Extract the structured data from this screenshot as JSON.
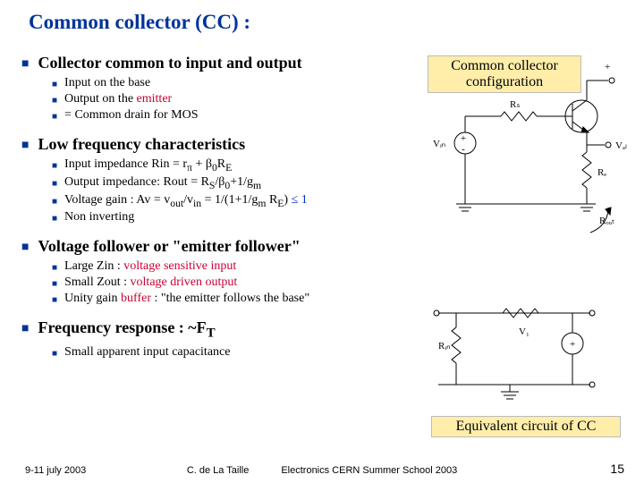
{
  "title": "Common collector (CC)  :",
  "bullets": [
    {
      "level": 1,
      "t": "Collector common to input and output"
    },
    {
      "level": 2,
      "t": "Input on the base"
    },
    {
      "level": 2,
      "html": "Output on the <span class='red'>emitter</span>"
    },
    {
      "level": 2,
      "t": "= Common drain for MOS"
    },
    {
      "level": 0
    },
    {
      "level": 1,
      "t": "Low frequency characteristics"
    },
    {
      "level": 2,
      "html": "Input impedance Rin = r<sub>π</sub> + β<sub>0</sub>R<sub>E</sub>"
    },
    {
      "level": 2,
      "html": "Output impedance: Rout = R<sub>S</sub>/β<sub>0</sub>+1/g<sub>m</sub>"
    },
    {
      "level": 2,
      "html": "Voltage gain : Av = v<sub>out</sub>/v<sub>in</sub> = 1/(1+1/g<sub>m</sub> R<sub>E</sub>) <span class='blue'>≤ 1</span>"
    },
    {
      "level": 2,
      "t": "Non inverting"
    },
    {
      "level": 0
    },
    {
      "level": 1,
      "t": "Voltage follower or \"emitter follower\""
    },
    {
      "level": 2,
      "html": "Large Zin : <span class='red'>voltage sensitive input</span>"
    },
    {
      "level": 2,
      "html": "Small Zout : <span class='red'>voltage driven output</span>"
    },
    {
      "level": 2,
      "html": "Unity gain  <span class='red'>buffer</span> : \"the emitter follows the base\""
    },
    {
      "level": 0
    },
    {
      "level": 1,
      "html": "Frequency response  : ~F<sub>T</sub>"
    },
    {
      "level": 2,
      "t": "Small apparent input capacitance"
    }
  ],
  "labels": {
    "cap1a": "Common collector",
    "cap1b": "configuration",
    "cap2": "Equivalent circuit of CC",
    "plus": "+",
    "minus": "-",
    "Rs": "Rₛ",
    "Vin": "Vᵢₙ",
    "Vₐl": "Vₐₗ",
    "RE": "Rₑ",
    "Rout": "Rₒᵤₜ",
    "Rin": "Rᵢₙ",
    "V1": "V₁"
  },
  "footer": {
    "left": "9-11 july 2003",
    "center_a": "C. de La Taille",
    "center_b": "Electronics CERN Summer School 2003",
    "page": "15"
  }
}
